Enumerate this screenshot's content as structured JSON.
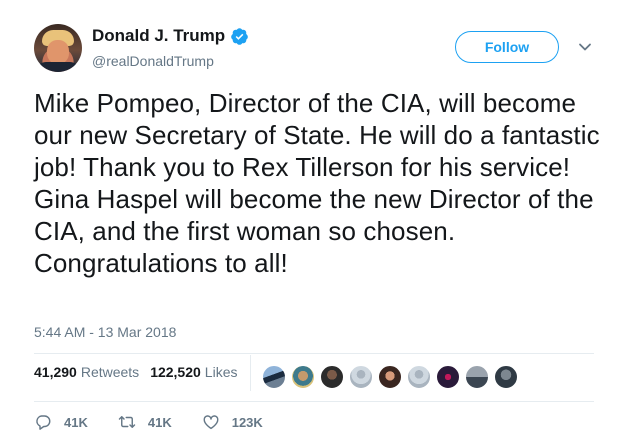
{
  "user": {
    "display_name": "Donald J. Trump",
    "handle": "@realDonaldTrump",
    "verified": true
  },
  "follow_label": "Follow",
  "tweet": {
    "text": "Mike Pompeo, Director of the CIA, will become our new Secretary of State. He will do a fantastic job! Thank you to Rex Tillerson for his service! Gina Haspel will become the new Director of the CIA, and the first woman so chosen. Congratulations to all!",
    "timestamp": "5:44 AM - 13 Mar 2018"
  },
  "stats": {
    "retweets_count": "41,290",
    "retweets_label": "Retweets",
    "likes_count": "122,520",
    "likes_label": "Likes"
  },
  "likers_count_shown": 9,
  "actions": {
    "replies": "41K",
    "retweets": "41K",
    "likes": "123K"
  },
  "colors": {
    "accent": "#1da1f2",
    "text": "#14171a",
    "muted": "#657786",
    "divider": "#e6ecf0"
  }
}
